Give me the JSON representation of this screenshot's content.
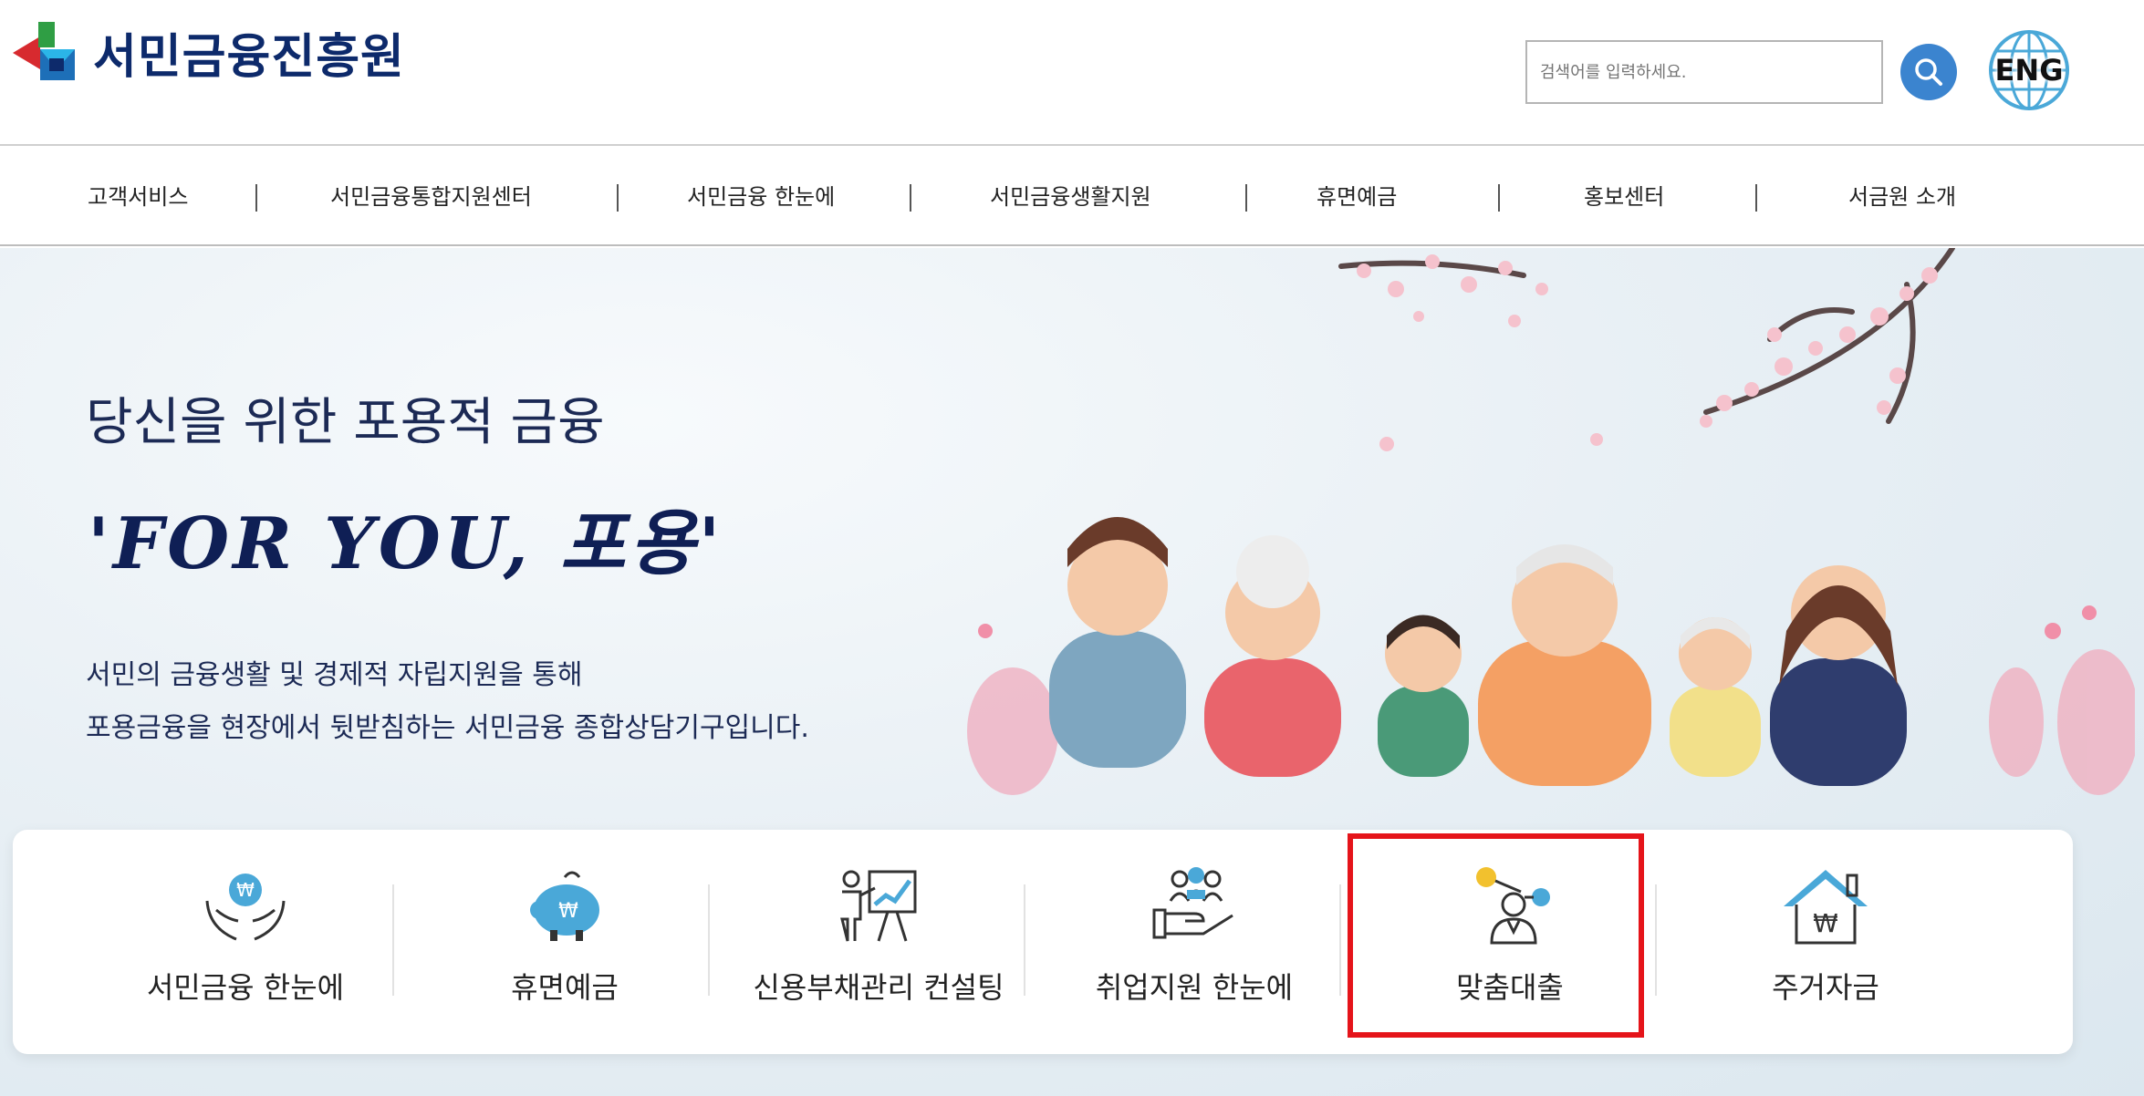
{
  "header": {
    "logo_text": "서민금융진흥원",
    "search_placeholder": "검색어를 입력하세요.",
    "lang_button": "ENG",
    "colors": {
      "brand_navy": "#0d2a6b",
      "search_blue": "#3b84cf",
      "globe": "#4aa8d8"
    }
  },
  "nav": {
    "items": [
      {
        "label": "고객서비스"
      },
      {
        "label": "서민금융통합지원센터"
      },
      {
        "label": "서민금융 한눈에"
      },
      {
        "label": "서민금융생활지원"
      },
      {
        "label": "휴면예금"
      },
      {
        "label": "홍보센터"
      },
      {
        "label": "서금원 소개"
      }
    ]
  },
  "hero": {
    "title": "당신을 위한 포용적 금융",
    "slogan": "'FOR YOU, 포용'",
    "desc_line1": "서민의 금융생활 및 경제적 자립지원을 통해",
    "desc_line2": "포용금융을 현장에서 뒷받침하는 서민금융 종합상담기구입니다."
  },
  "quick_menu": {
    "items": [
      {
        "label": "서민금융 한눈에",
        "icon": "hands-won-icon"
      },
      {
        "label": "휴면예금",
        "icon": "piggy-bank-icon"
      },
      {
        "label": "신용부채관리 컨설팅",
        "icon": "presentation-chart-icon"
      },
      {
        "label": "취업지원 한눈에",
        "icon": "hand-people-icon"
      },
      {
        "label": "맞춤대출",
        "icon": "person-network-icon"
      },
      {
        "label": "주거자금",
        "icon": "house-won-icon"
      }
    ],
    "highlighted_item": "맞춤대출",
    "highlight_color": "#e5141a"
  }
}
